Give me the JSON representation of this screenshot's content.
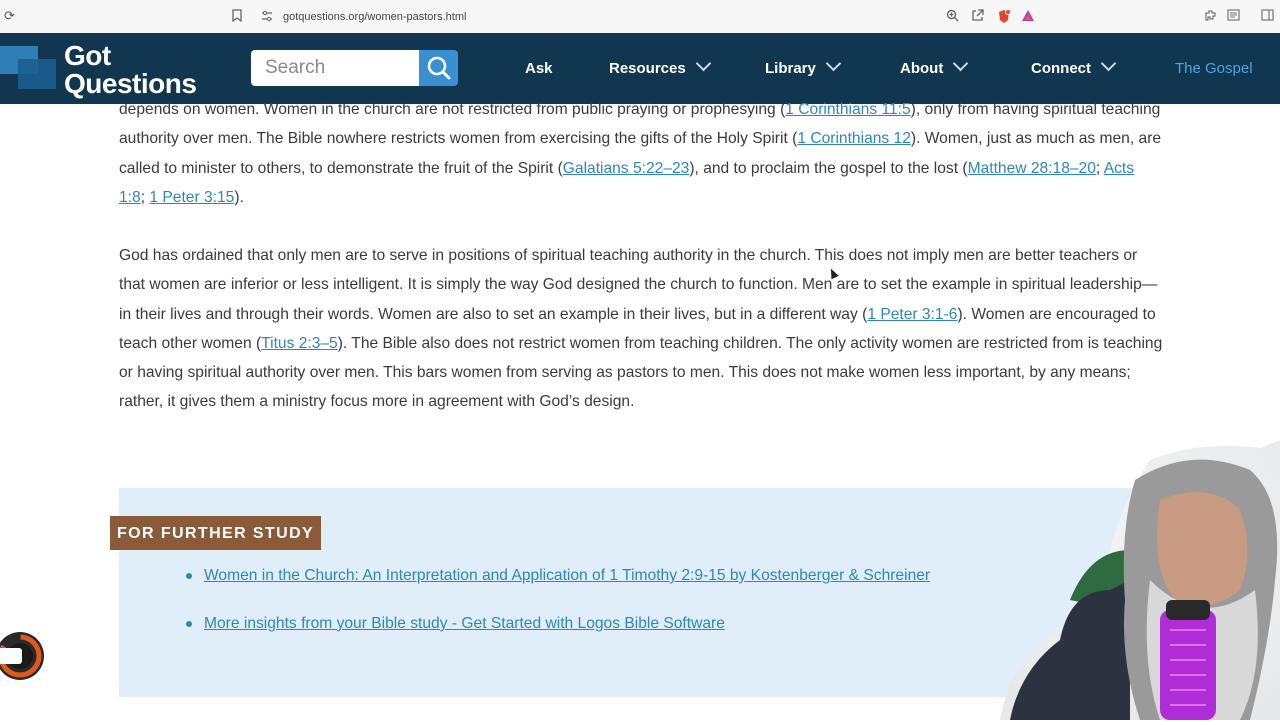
{
  "browser": {
    "url": "gotquestions.org/women-pastors.html",
    "icons": [
      "reload-icon",
      "bookmark-icon",
      "site-info-icon",
      "zoom-icon",
      "share-icon",
      "brave-shield-icon",
      "brave-rewards-icon",
      "extensions-icon",
      "reader-icon",
      "sidebar-icon"
    ]
  },
  "header": {
    "logo_line1": "Got",
    "logo_line2": "Questions",
    "search_placeholder": "Search",
    "nav": {
      "ask": "Ask",
      "resources": "Resources",
      "library": "Library",
      "about": "About",
      "connect": "Connect",
      "gospel": "The Gospel"
    },
    "colors": {
      "bg": "#11364f",
      "accent": "#3a8fd0",
      "gospel": "#4ba6e0"
    }
  },
  "article": {
    "p1": {
      "t1": "depends on women. Women in the church are not restricted from public praying or prophesying (",
      "l1": "1 Corinthians 11:5",
      "t2": "), only from having spiritual teaching authority over men. The Bible nowhere restricts women from exercising the gifts of the Holy Spirit (",
      "l2": "1 Corinthians 12",
      "t3": "). Women, just as much as men, are called to minister to others, to demonstrate the fruit of the Spirit (",
      "l3": "Galatians 5:22–23",
      "t4": "), and to proclaim the gospel to the lost (",
      "l4": "Matthew 28:18–20",
      "t5": "; ",
      "l5": "Acts 1:8",
      "t6": "; ",
      "l6": "1 Peter 3:15",
      "t7": ")."
    },
    "p2": {
      "t1": "God has ordained that only men are to serve in positions of spiritual teaching authority in the church. This does not imply men are better teachers or that women are inferior or less intelligent. It is simply the way God designed the church to function. Men are to set the example in spiritual leadership—in their lives and through their words. Women are also to set an example in their lives, but in a different way (",
      "l1": "1 Peter 3:1-6",
      "t2": "). Women are encouraged to teach other women (",
      "l2": "Titus 2:3–5",
      "t3": "). The Bible also does not restrict women from teaching children. The only activity women are restricted from is teaching or having spiritual authority over men. This bars women from serving as pastors to men. This does not make women less important, by any means; rather, it gives them a ministry focus more in agreement with God’s design."
    }
  },
  "further_study": {
    "title": "FOR FURTHER STUDY",
    "links": [
      "Women in the Church: An Interpretation and Application of 1 Timothy 2:9-15 by Kostenberger & Schreiner",
      "More insights from your Bible study - Get Started with Logos Bible Software"
    ],
    "colors": {
      "panel": "#dfeef8",
      "tag": "#8b5a38",
      "link": "#2f86b8"
    }
  }
}
